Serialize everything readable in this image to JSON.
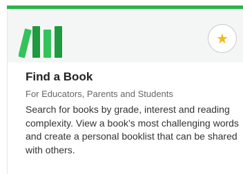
{
  "card": {
    "title": "Find a Book",
    "subtitle": "For Educators, Parents and Students",
    "description": "Search for books by grade, interest and reading complexity. View a book’s most challenging words and create a personal booklist that can be shared with others.",
    "icon": "books-icon",
    "favorite_icon": "star-icon"
  },
  "colors": {
    "accent_green": "#2db34a",
    "book_dark_green": "#1f9a3f",
    "book_light_green": "#34c25a",
    "star_gold": "#f5b81c",
    "header_background": "#f4f6f6"
  }
}
